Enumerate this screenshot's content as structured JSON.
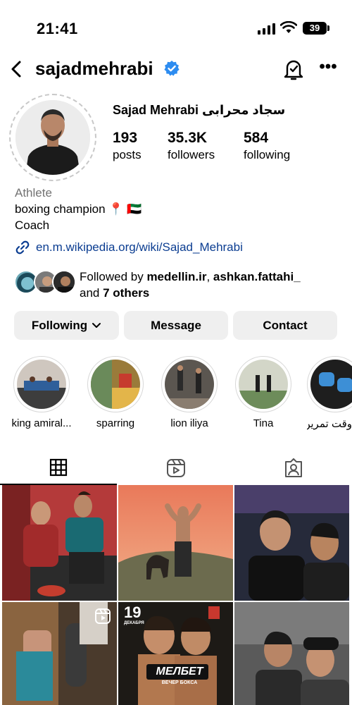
{
  "status_bar": {
    "time": "21:41",
    "battery": "39"
  },
  "header": {
    "username": "sajadmehrabi"
  },
  "profile": {
    "full_name": "Sajad Mehrabi سجاد محرابی",
    "stats": [
      {
        "value": "193",
        "label": "posts"
      },
      {
        "value": "35.3K",
        "label": "followers"
      },
      {
        "value": "584",
        "label": "following"
      }
    ],
    "category": "Athlete",
    "bio_line1": "boxing champion 📍 🇦🇪",
    "bio_line2": "Coach",
    "link": "en.m.wikipedia.org/wiki/Sajad_Mehrabi"
  },
  "followed_by": {
    "prefix": "Followed by ",
    "user1": "medellin.ir",
    "separator": ", ",
    "user2": "ashkan.fattahi_",
    "and_text": "and ",
    "others": "7 others"
  },
  "buttons": {
    "following": "Following",
    "message": "Message",
    "contact": "Contact"
  },
  "highlights": [
    {
      "label": "king amiral..."
    },
    {
      "label": "sparring"
    },
    {
      "label": "lion iliya"
    },
    {
      "label": "Tina"
    },
    {
      "label": "وقت تمرین"
    }
  ],
  "posts": {
    "post5_badge_number": "19",
    "post5_badge_month": "ДЕКАБРЯ",
    "post5_brand": "МЕЛБЕТ",
    "post5_subtitle": "ВЕЧЕР БОКСА"
  }
}
